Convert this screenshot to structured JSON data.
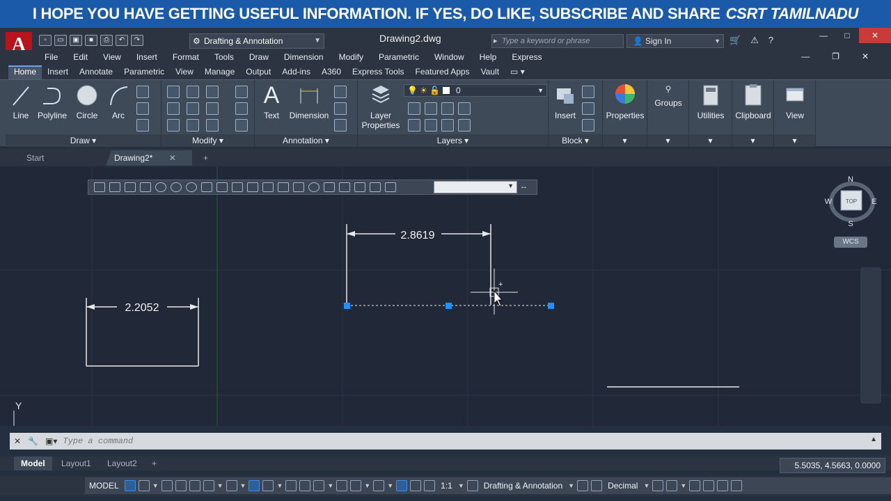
{
  "banner": {
    "text": "I HOPE YOU HAVE GETTING USEFUL INFORMATION. IF YES, DO LIKE, SUBSCRIBE AND SHARE",
    "brand": "CSRT TAMILNADU"
  },
  "titlebar": {
    "app_logo": "A",
    "workspace": "Drafting & Annotation",
    "document": "Drawing2.dwg",
    "search_placeholder": "Type a keyword or phrase",
    "signin": "Sign In"
  },
  "menu": [
    "File",
    "Edit",
    "View",
    "Insert",
    "Format",
    "Tools",
    "Draw",
    "Dimension",
    "Modify",
    "Parametric",
    "Window",
    "Help",
    "Express"
  ],
  "ribbon_tabs": [
    "Home",
    "Insert",
    "Annotate",
    "Parametric",
    "View",
    "Manage",
    "Output",
    "Add-ins",
    "A360",
    "Express Tools",
    "Featured Apps",
    "Vault"
  ],
  "ribbon": {
    "draw": {
      "title": "Draw",
      "line": "Line",
      "polyline": "Polyline",
      "circle": "Circle",
      "arc": "Arc"
    },
    "modify": {
      "title": "Modify"
    },
    "annotation": {
      "title": "Annotation",
      "text": "Text",
      "dimension": "Dimension"
    },
    "layers": {
      "title": "Layers",
      "layer_properties_1": "Layer",
      "layer_properties_2": "Properties",
      "current_layer": "0"
    },
    "block": {
      "title": "Block",
      "insert": "Insert"
    },
    "properties": "Properties",
    "groups": "Groups",
    "utilities": "Utilities",
    "clipboard": "Clipboard",
    "view": "View"
  },
  "doc_tabs": {
    "start": "Start",
    "drawing": "Drawing2*"
  },
  "drawing": {
    "dim1": "2.2052",
    "dim2": "2.8619",
    "axis_y": "Y"
  },
  "viewcube": {
    "n": "N",
    "s": "S",
    "e": "E",
    "w": "W",
    "top": "TOP",
    "wcs": "WCS"
  },
  "command": {
    "placeholder": "Type a command"
  },
  "layout_tabs": [
    "Model",
    "Layout1",
    "Layout2"
  ],
  "coords": "5.5035, 4.5663, 0.0000",
  "status": {
    "model": "MODEL",
    "scale": "1:1",
    "workspace": "Drafting & Annotation",
    "units": "Decimal"
  },
  "colors": {
    "accent": "#1e90ff",
    "banner": "#1a5aa8",
    "background": "#212938"
  }
}
